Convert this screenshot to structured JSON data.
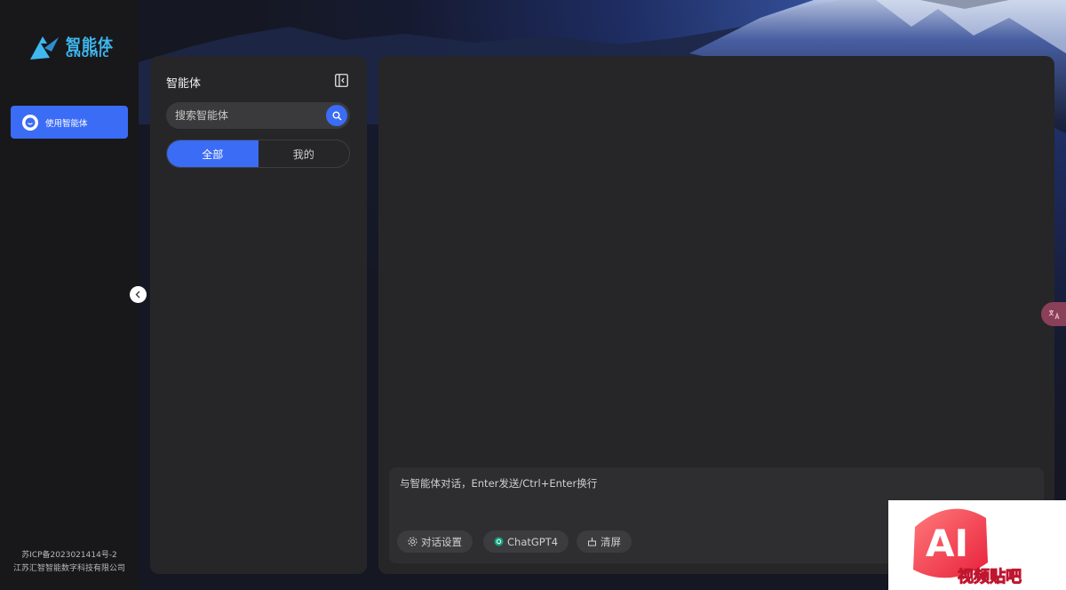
{
  "brand": {
    "cn": "智能体",
    "en": "GNOMIC"
  },
  "rail": {
    "active_item_label": "使用智能体"
  },
  "footer": {
    "icp": "苏ICP备2023021414号-2",
    "company": "江苏汇智智能数字科技有限公司"
  },
  "panel": {
    "title": "智能体",
    "search_placeholder": "搜索智能体",
    "tabs": [
      {
        "label": "全部",
        "active": true
      },
      {
        "label": "我的",
        "active": false
      }
    ]
  },
  "composer": {
    "placeholder": "与智能体对话，Enter发送/Ctrl+Enter换行",
    "chips": {
      "settings": "对话设置",
      "model": "ChatGPT4",
      "clear": "清屏"
    }
  },
  "translate_fab": {
    "icon": "translate-icon"
  },
  "watermark": {
    "text": "AI",
    "subtext": "视频贴吧"
  },
  "colors": {
    "accent": "#3b6cf6",
    "panel_bg": "#262628",
    "rail_bg": "#18181a",
    "brand": "#3fb8f0"
  }
}
